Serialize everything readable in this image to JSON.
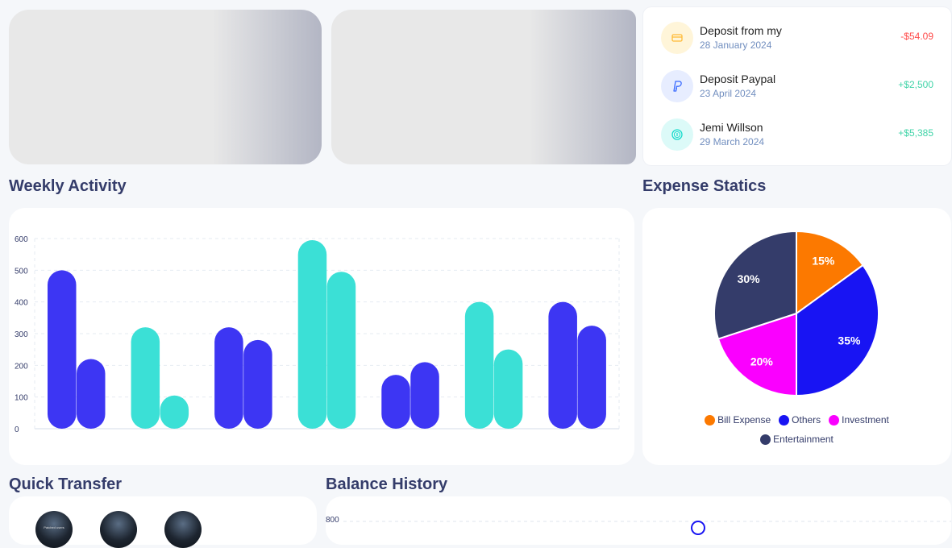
{
  "transactions": [
    {
      "title": "Deposit from my",
      "date": "28 January 2024",
      "amount": "-$54.09",
      "amount_color": "#ff4b4a",
      "icon": "card-icon",
      "icon_bg": "#fff5d9",
      "icon_color": "#ffbb38"
    },
    {
      "title": "Deposit Paypal",
      "date": "23 April 2024",
      "amount": "+$2,500",
      "amount_color": "#41d4a8",
      "icon": "paypal-icon",
      "icon_bg": "#e7edff",
      "icon_color": "#396aff"
    },
    {
      "title": "Jemi Willson",
      "date": "29 March 2024",
      "amount": "+$5,385",
      "amount_color": "#41d4a8",
      "icon": "coin-icon",
      "icon_bg": "#dcfaf8",
      "icon_color": "#16dbcc"
    }
  ],
  "weekly_activity": {
    "title": "Weekly Activity",
    "chart_data": {
      "type": "bar",
      "ylim": [
        0,
        600
      ],
      "yticks": [
        "0",
        "100",
        "200",
        "300",
        "400",
        "500",
        "600"
      ],
      "grid": true,
      "bars": [
        {
          "x": 1,
          "value": 500,
          "color": "#3d36f3"
        },
        {
          "x": 2,
          "value": 220,
          "color": "#3d36f3"
        },
        {
          "x": 3,
          "value": 320,
          "color": "#3be0d6"
        },
        {
          "x": 4,
          "value": 105,
          "color": "#3be0d6"
        },
        {
          "x": 5,
          "value": 320,
          "color": "#3d36f3"
        },
        {
          "x": 6,
          "value": 280,
          "color": "#3d36f3"
        },
        {
          "x": 7,
          "value": 595,
          "color": "#3be0d6"
        },
        {
          "x": 8,
          "value": 495,
          "color": "#3be0d6"
        },
        {
          "x": 9,
          "value": 170,
          "color": "#3d36f3"
        },
        {
          "x": 10,
          "value": 210,
          "color": "#3d36f3"
        },
        {
          "x": 11,
          "value": 400,
          "color": "#3be0d6"
        },
        {
          "x": 12,
          "value": 250,
          "color": "#3be0d6"
        },
        {
          "x": 13,
          "value": 400,
          "color": "#3d36f3"
        },
        {
          "x": 14,
          "value": 325,
          "color": "#3d36f3"
        }
      ]
    }
  },
  "expense_statics": {
    "title": "Expense Statics",
    "chart_data": {
      "type": "pie",
      "slices": [
        {
          "label": "Bill Expense",
          "value": 15,
          "text": "15%",
          "color": "#fc7900"
        },
        {
          "label": "Others",
          "value": 35,
          "text": "35%",
          "color": "#1814f3"
        },
        {
          "label": "Investment",
          "value": 20,
          "text": "20%",
          "color": "#fa00ff"
        },
        {
          "label": "Entertainment",
          "value": 30,
          "text": "30%",
          "color": "#343c6a"
        }
      ],
      "legend_position": "bottom"
    }
  },
  "quick_transfer": {
    "title": "Quick Transfer",
    "avatar_caption": "Patched users"
  },
  "balance_history": {
    "title": "Balance History",
    "y_top_tick": "800"
  }
}
